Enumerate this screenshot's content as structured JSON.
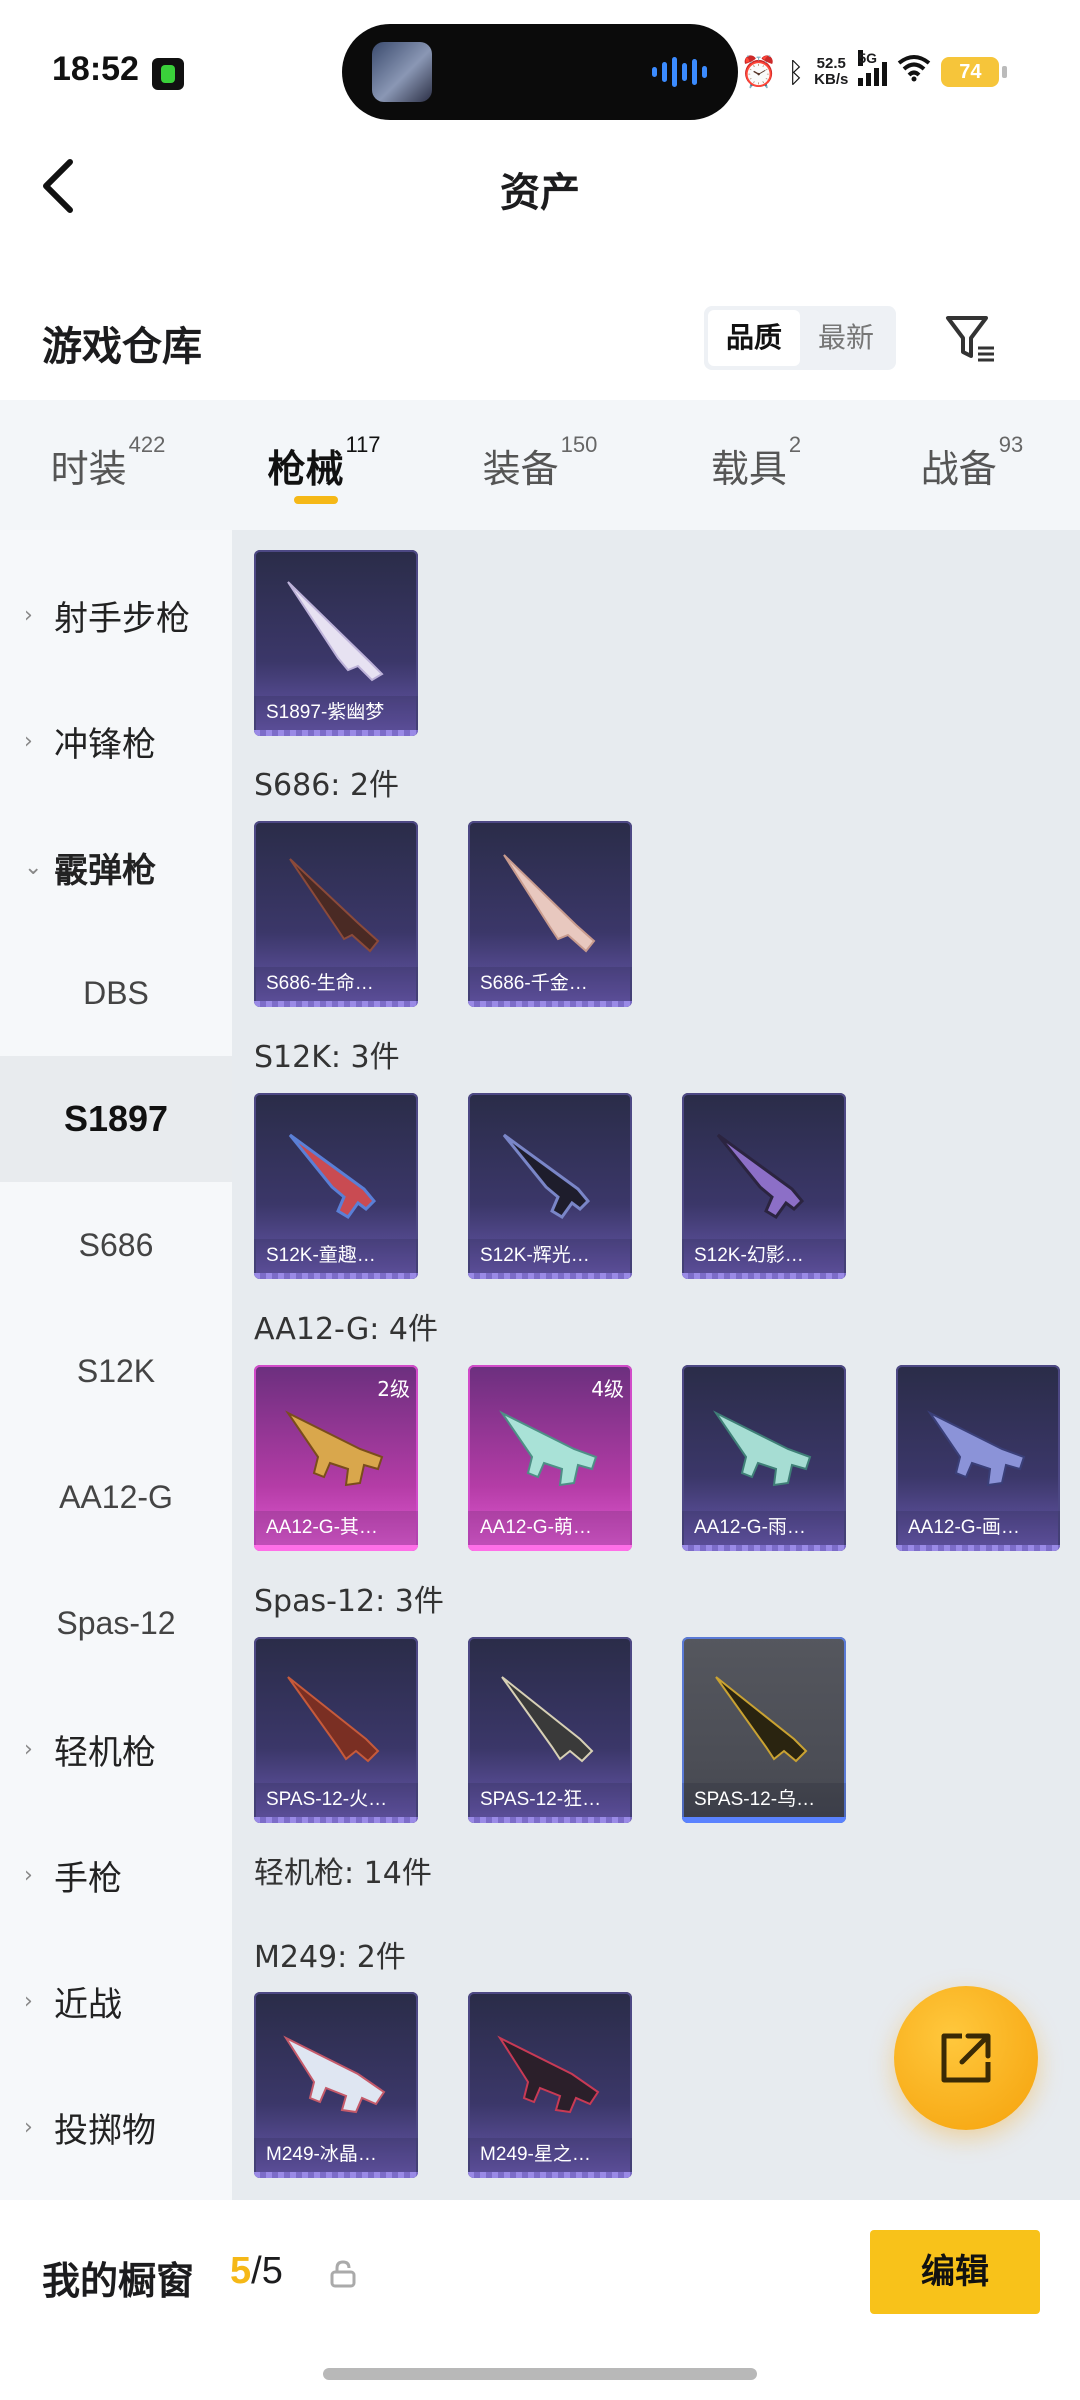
{
  "status_bar": {
    "time": "18:52",
    "net_speed_value": "52.5",
    "net_speed_unit": "KB/s",
    "network_type": "5G",
    "battery": "74"
  },
  "header": {
    "title": "资产"
  },
  "section": {
    "title": "游戏仓库",
    "sort_options": [
      "品质",
      "最新"
    ],
    "sort_active": "品质"
  },
  "tabs": [
    {
      "label": "时装",
      "count": "422"
    },
    {
      "label": "枪械",
      "count": "117"
    },
    {
      "label": "装备",
      "count": "150"
    },
    {
      "label": "载具",
      "count": "2"
    },
    {
      "label": "战备",
      "count": "93"
    }
  ],
  "active_tab": "枪械",
  "sidebar": {
    "items": [
      {
        "label": "射手步枪",
        "type": "category",
        "expanded": false
      },
      {
        "label": "冲锋枪",
        "type": "category",
        "expanded": false
      },
      {
        "label": "霰弹枪",
        "type": "category",
        "expanded": true
      },
      {
        "label": "DBS",
        "type": "sub"
      },
      {
        "label": "S1897",
        "type": "sub",
        "active": true
      },
      {
        "label": "S686",
        "type": "sub"
      },
      {
        "label": "S12K",
        "type": "sub"
      },
      {
        "label": "AA12-G",
        "type": "sub"
      },
      {
        "label": "Spas-12",
        "type": "sub"
      },
      {
        "label": "轻机枪",
        "type": "category",
        "expanded": false
      },
      {
        "label": "手枪",
        "type": "category",
        "expanded": false
      },
      {
        "label": "近战",
        "type": "category",
        "expanded": false
      },
      {
        "label": "投掷物",
        "type": "category",
        "expanded": false
      }
    ]
  },
  "content": {
    "groups": [
      {
        "label": "",
        "items": [
          {
            "name": "S1897-紫幽梦",
            "rarity": "purple"
          }
        ]
      },
      {
        "label": "S686: 2件",
        "items": [
          {
            "name": "S686-生命…",
            "rarity": "purple"
          },
          {
            "name": "S686-千金…",
            "rarity": "purple"
          }
        ]
      },
      {
        "label": "S12K: 3件",
        "items": [
          {
            "name": "S12K-童趣…",
            "rarity": "purple"
          },
          {
            "name": "S12K-辉光…",
            "rarity": "purple"
          },
          {
            "name": "S12K-幻影…",
            "rarity": "purple"
          }
        ]
      },
      {
        "label": "AA12-G: 4件",
        "items": [
          {
            "name": "AA12-G-其…",
            "rarity": "pink",
            "level": "2级"
          },
          {
            "name": "AA12-G-萌…",
            "rarity": "pink",
            "level": "4级"
          },
          {
            "name": "AA12-G-雨…",
            "rarity": "purple"
          },
          {
            "name": "AA12-G-画…",
            "rarity": "purple"
          }
        ]
      },
      {
        "label": "Spas-12: 3件",
        "items": [
          {
            "name": "SPAS-12-火…",
            "rarity": "purple"
          },
          {
            "name": "SPAS-12-狂…",
            "rarity": "purple"
          },
          {
            "name": "SPAS-12-乌…",
            "rarity": "gray"
          }
        ]
      },
      {
        "label": "轻机枪: 14件",
        "items": []
      },
      {
        "label": "M249: 2件",
        "items": [
          {
            "name": "M249-冰晶…",
            "rarity": "purple"
          },
          {
            "name": "M249-星之…",
            "rarity": "purple"
          }
        ]
      }
    ]
  },
  "bottom": {
    "showcase_label": "我的橱窗",
    "showcase_current": "5",
    "showcase_total": "5",
    "edit_label": "编辑"
  },
  "colors": {
    "accent": "#f5b817",
    "rarity_purple": "#6a5ab0",
    "rarity_pink": "#e45bd6",
    "rarity_gray": "#4b4d55"
  }
}
